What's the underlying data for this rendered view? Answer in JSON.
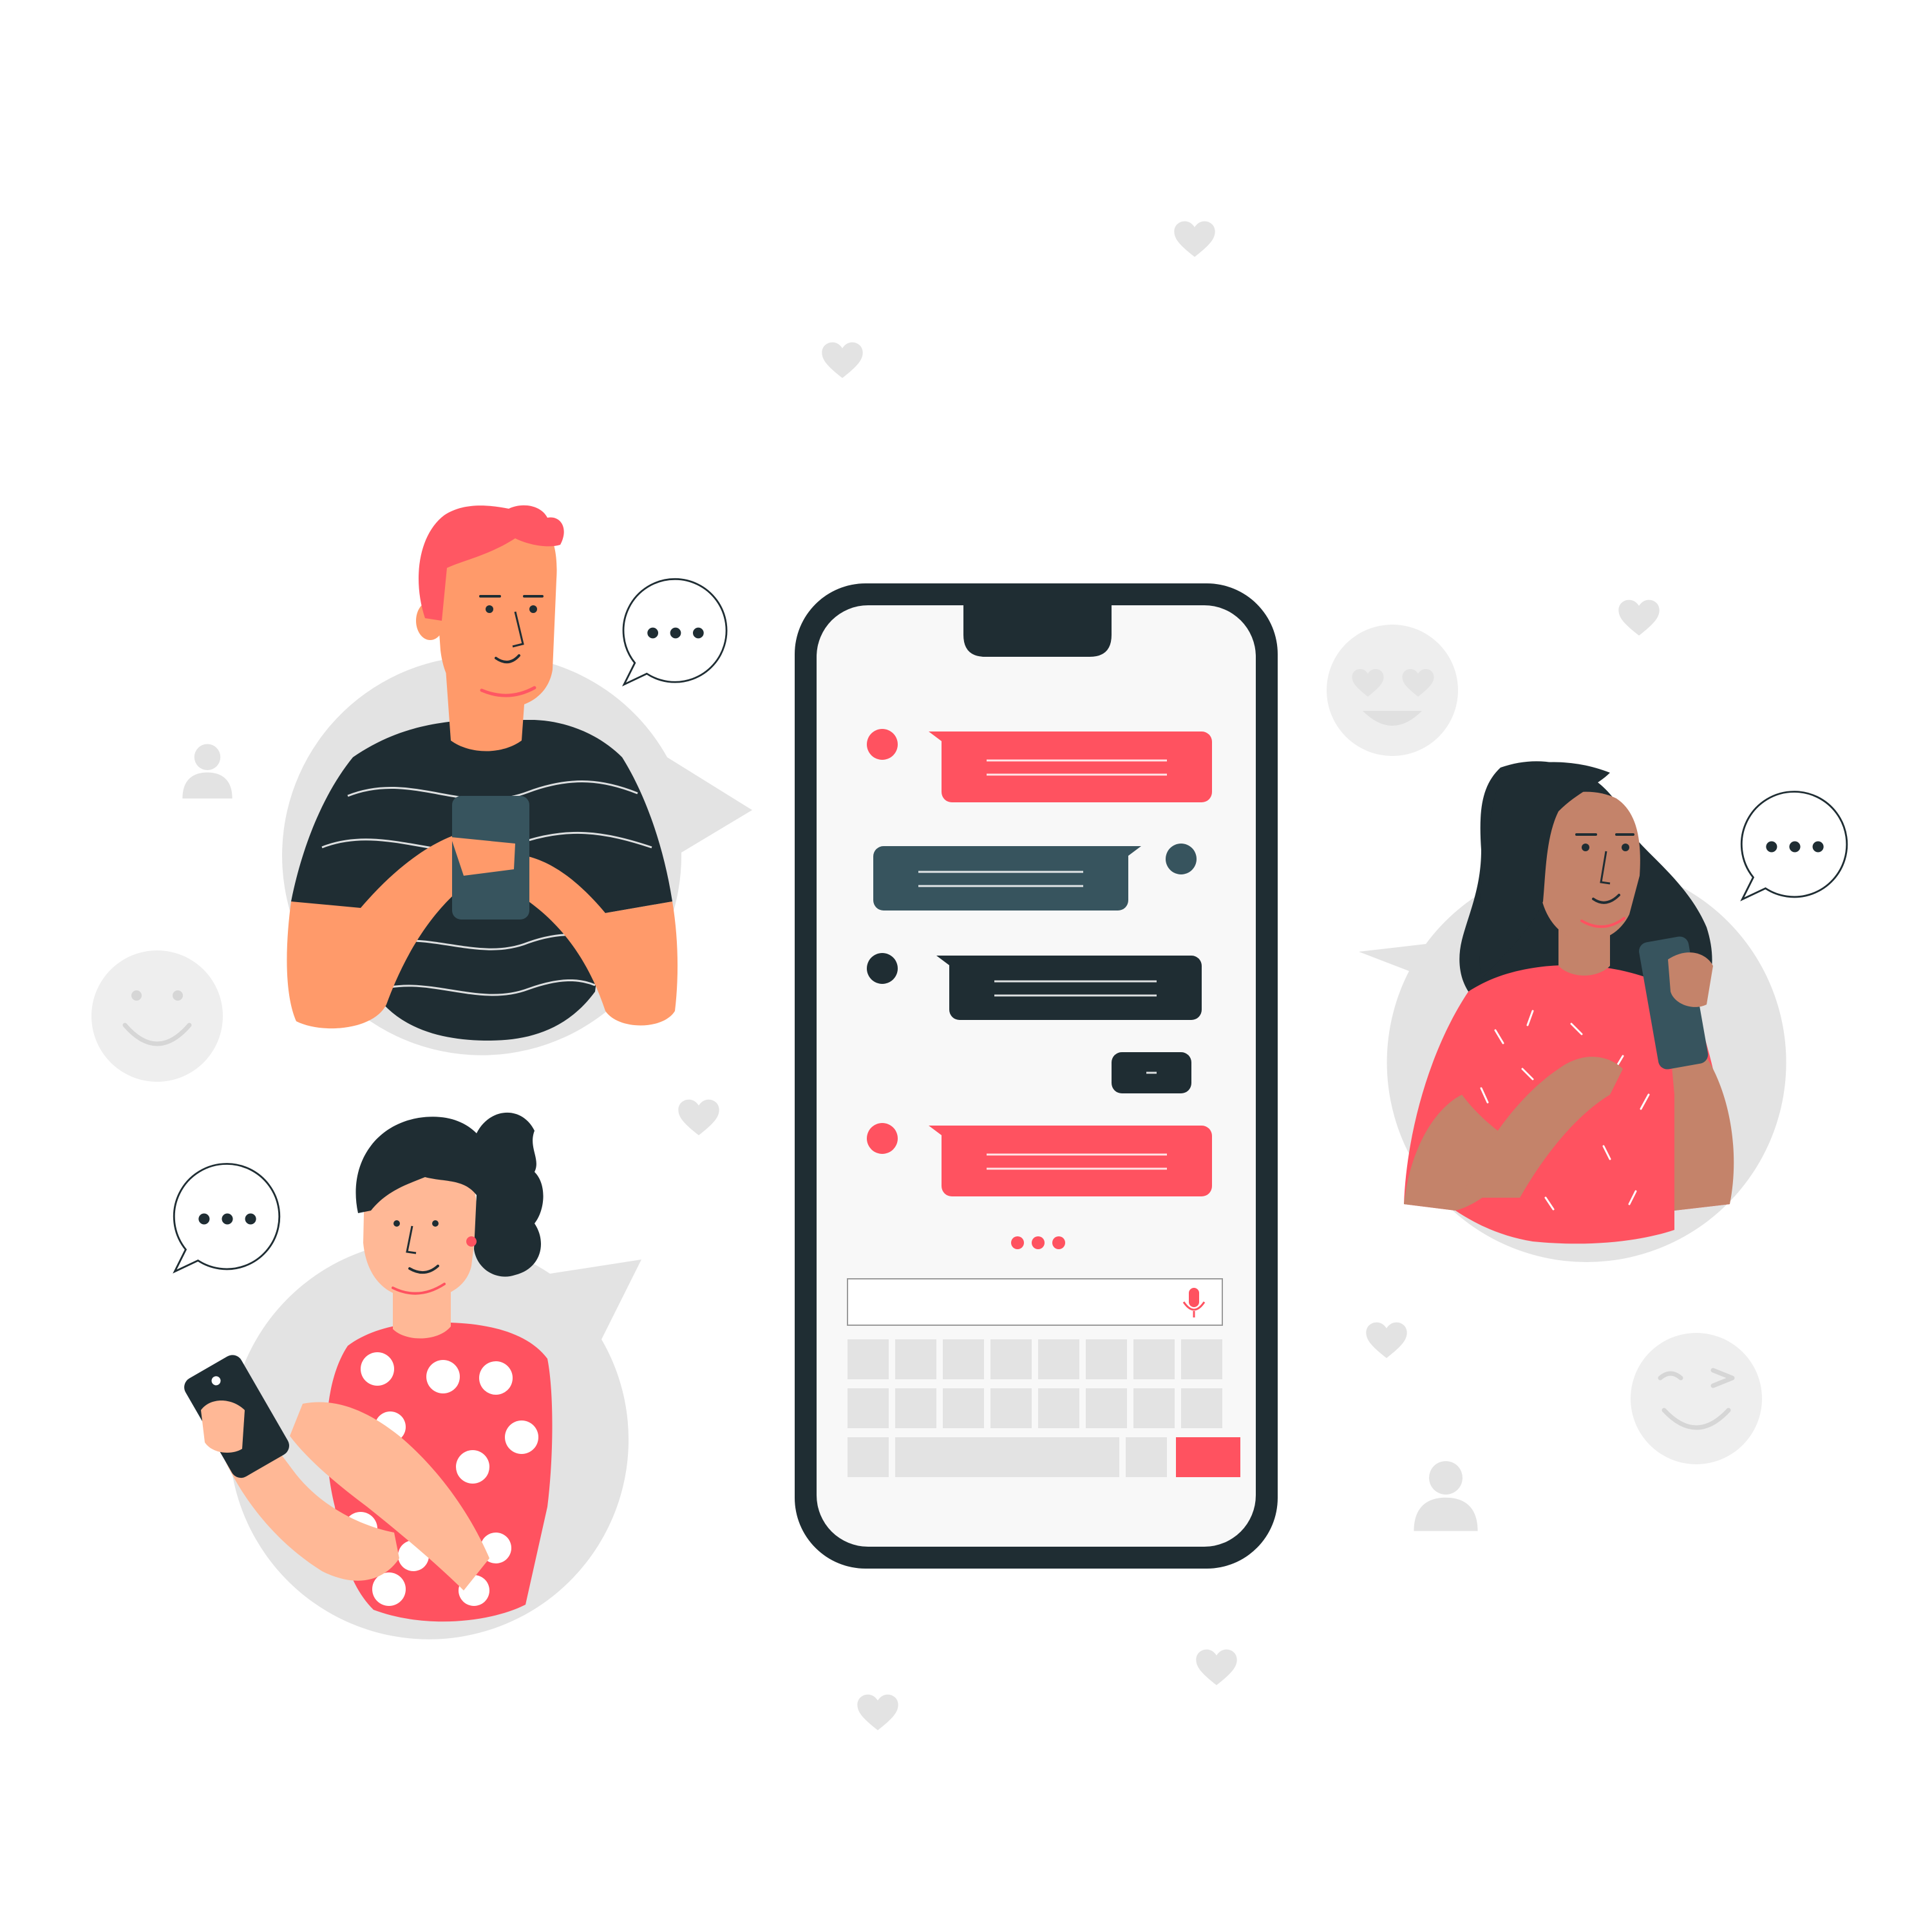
{
  "colors": {
    "background": "#ffffff",
    "accent_red": "#ff5260",
    "dark": "#1f2d33",
    "slate": "#37545e",
    "light_gray": "#e3e3e3",
    "screen": "#f8f8f8",
    "skin_light": "#ffb896",
    "skin_orange": "#ff9a6a",
    "skin_brown": "#c4836a",
    "hair_red": "#ff5763"
  },
  "icons": {
    "heart": "heart-icon",
    "smiley": "smiley-icon",
    "heart_eyes": "heart-eyes-emoji-icon",
    "wink": "wink-emoji-icon",
    "person": "person-icon",
    "typing_bubble": "typing-bubble-icon",
    "microphone": "microphone-icon"
  },
  "phone": {
    "messages": [
      {
        "sender": "other",
        "color": "#ff5260"
      },
      {
        "sender": "self",
        "color": "#37545e"
      },
      {
        "sender": "other",
        "color": "#1f2d33"
      },
      {
        "sender": "self",
        "color": "#1f2d33"
      },
      {
        "sender": "other",
        "color": "#ff5260"
      }
    ],
    "keyboard": {
      "rows": 3,
      "keys_per_row": 8
    }
  }
}
